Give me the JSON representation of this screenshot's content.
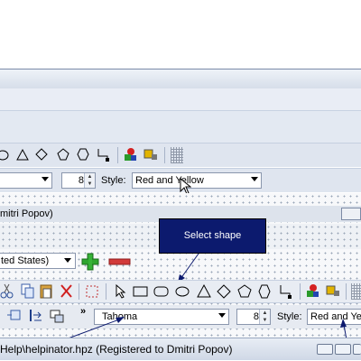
{
  "background_app": {
    "toolbar_style_label": "Style:",
    "font_size_value": "8",
    "style_value": "Red and Yellow"
  },
  "main_app": {
    "window_title_fragment": "mitri Popov)",
    "language_value": "ted States)",
    "callout_text": "Select shape",
    "font_name": "Tahoma",
    "font_size_value": "8",
    "style_label": "Style:",
    "style_value": "Red and Ye",
    "more_label": "»",
    "status_text": "Help\\helpinator.hpz (Registered to Dmitri Popov)"
  },
  "colors": {
    "callout_bg": "#0c1a6e",
    "add_green": "#2fa52f",
    "remove_red": "#d23a3a"
  }
}
